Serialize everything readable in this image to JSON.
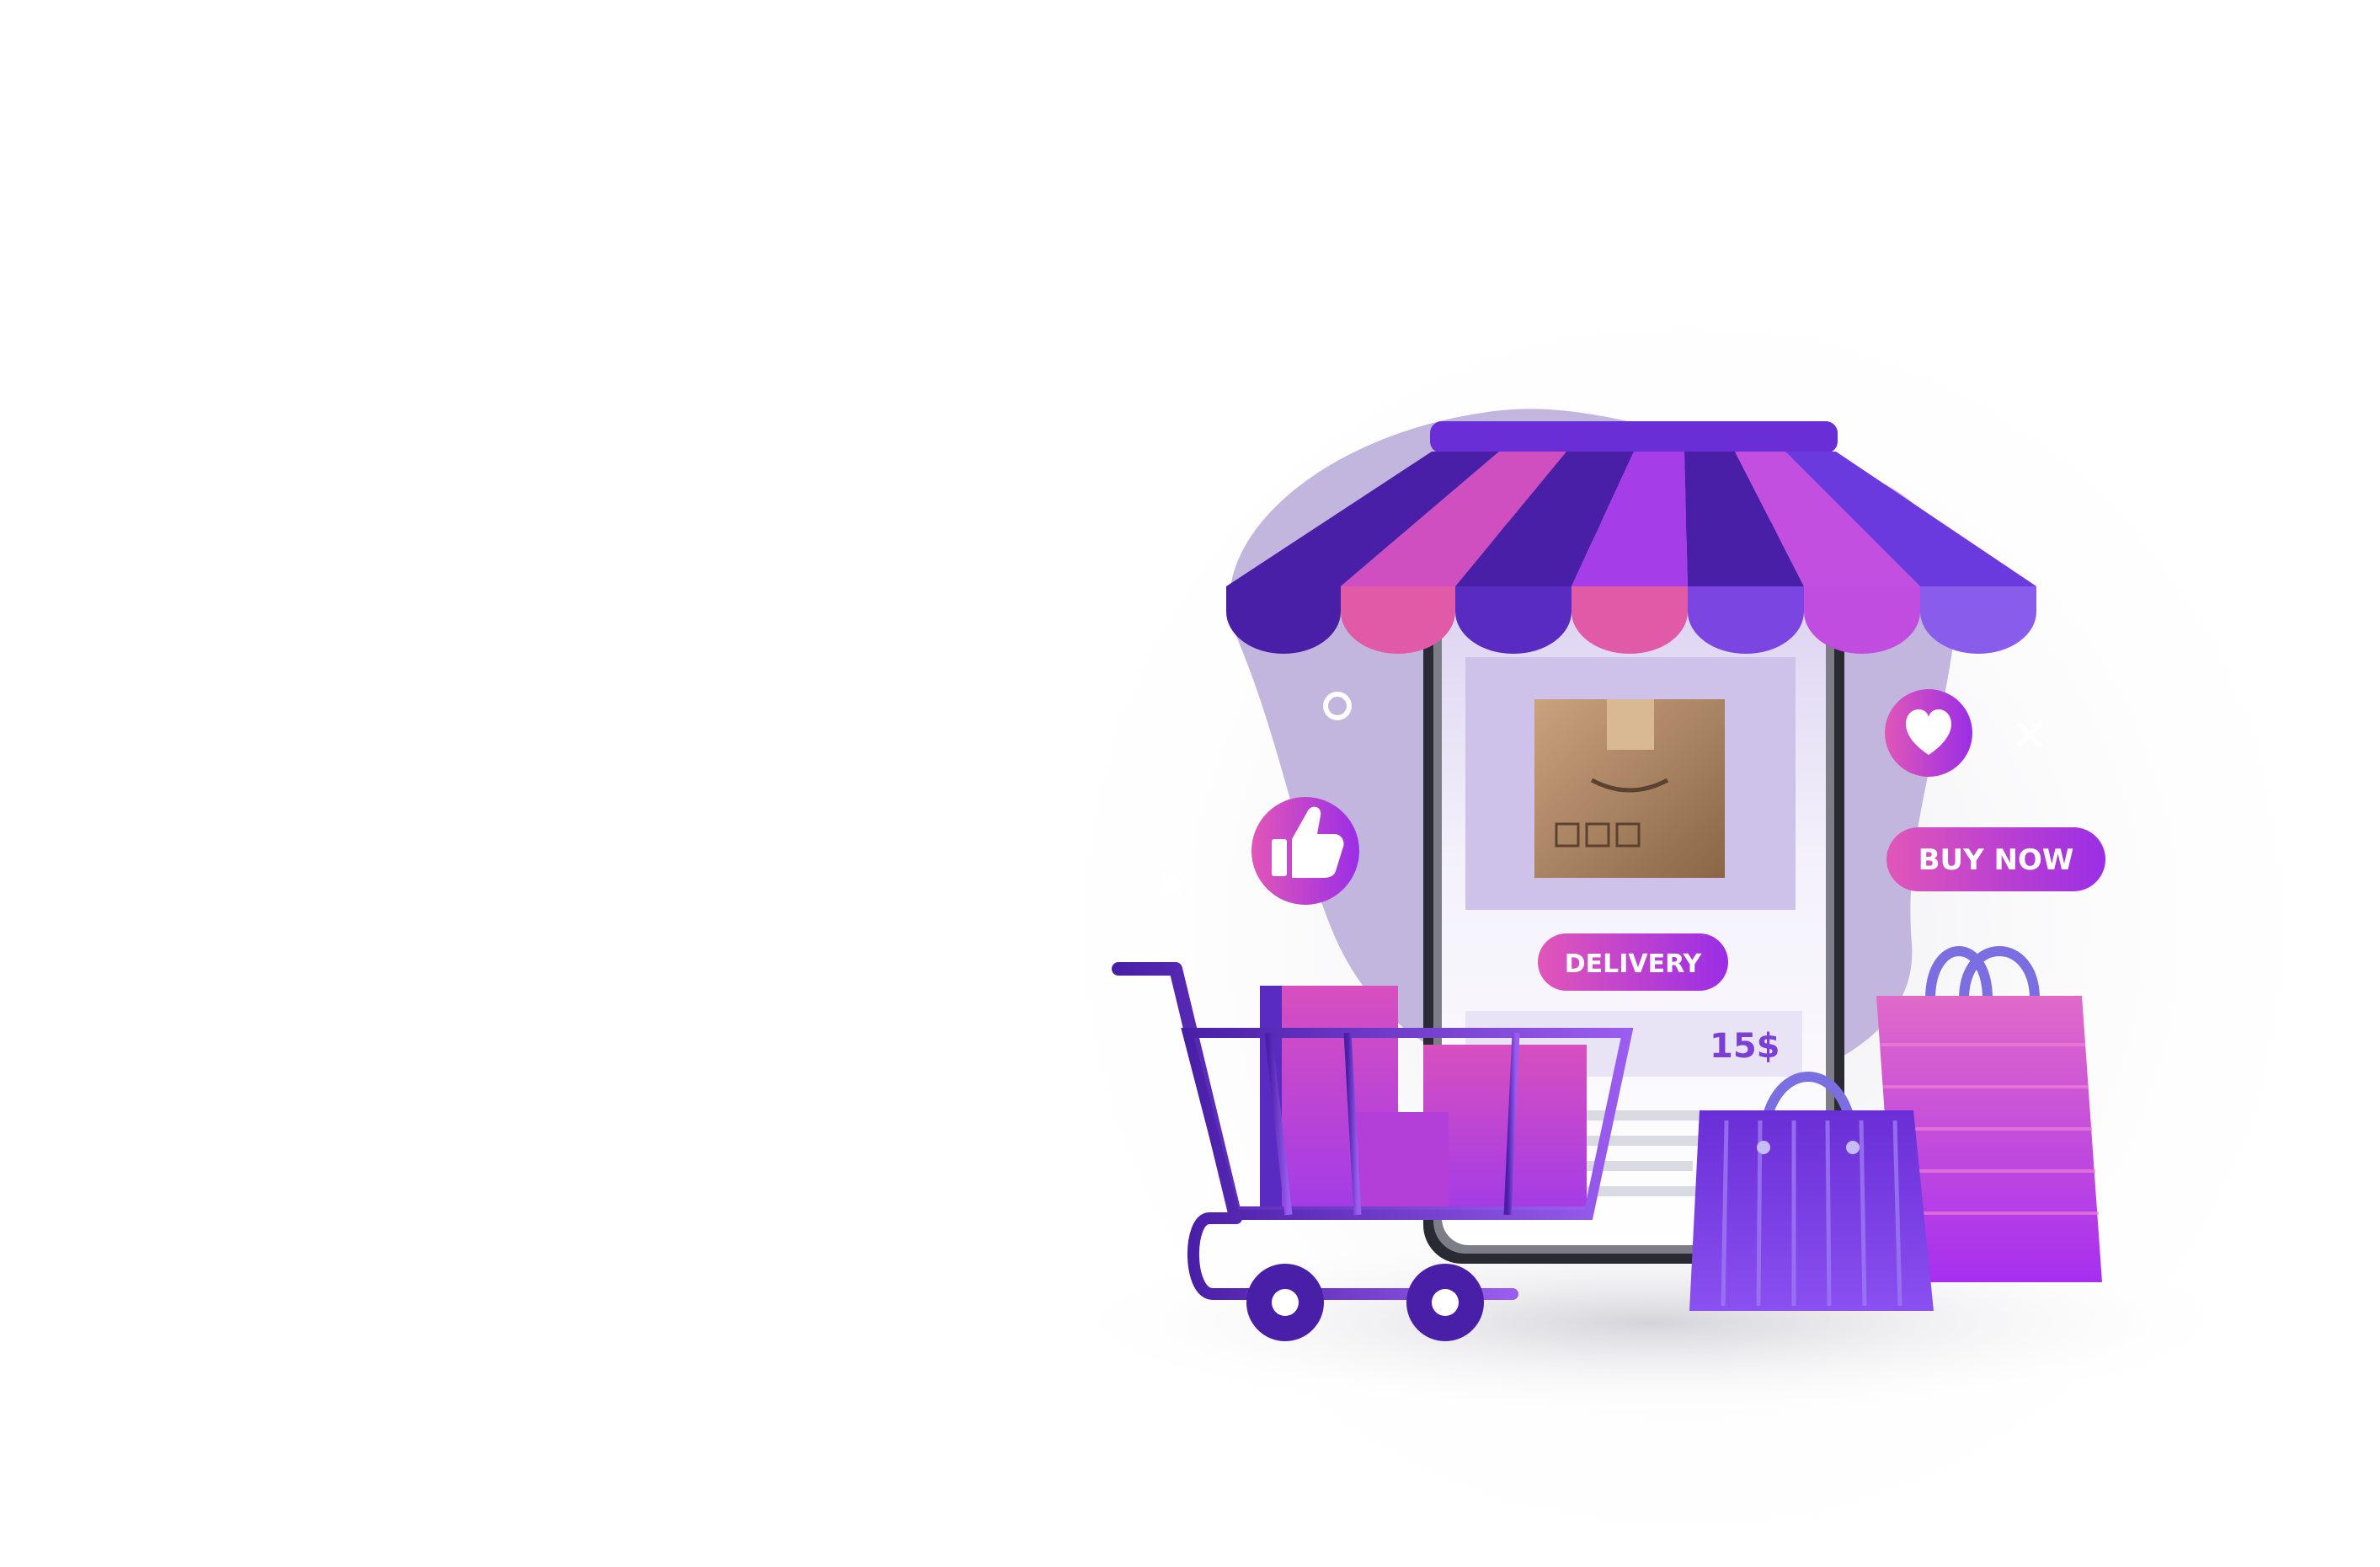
{
  "illustration": {
    "buttons": {
      "delivery": "DELIVERY",
      "buy_now": "BUY NOW"
    },
    "price": "15$",
    "icons": [
      "thumbs-up-icon",
      "heart-icon",
      "shopping-cart-icon",
      "shopping-bag-icon",
      "package-box-icon",
      "store-awning-icon"
    ],
    "colors": {
      "purple_dark": "#4a1fa8",
      "purple": "#8b2cf0",
      "magenta": "#d63fb0",
      "pink": "#e05fc0",
      "lavender": "#b9a9d6"
    }
  }
}
